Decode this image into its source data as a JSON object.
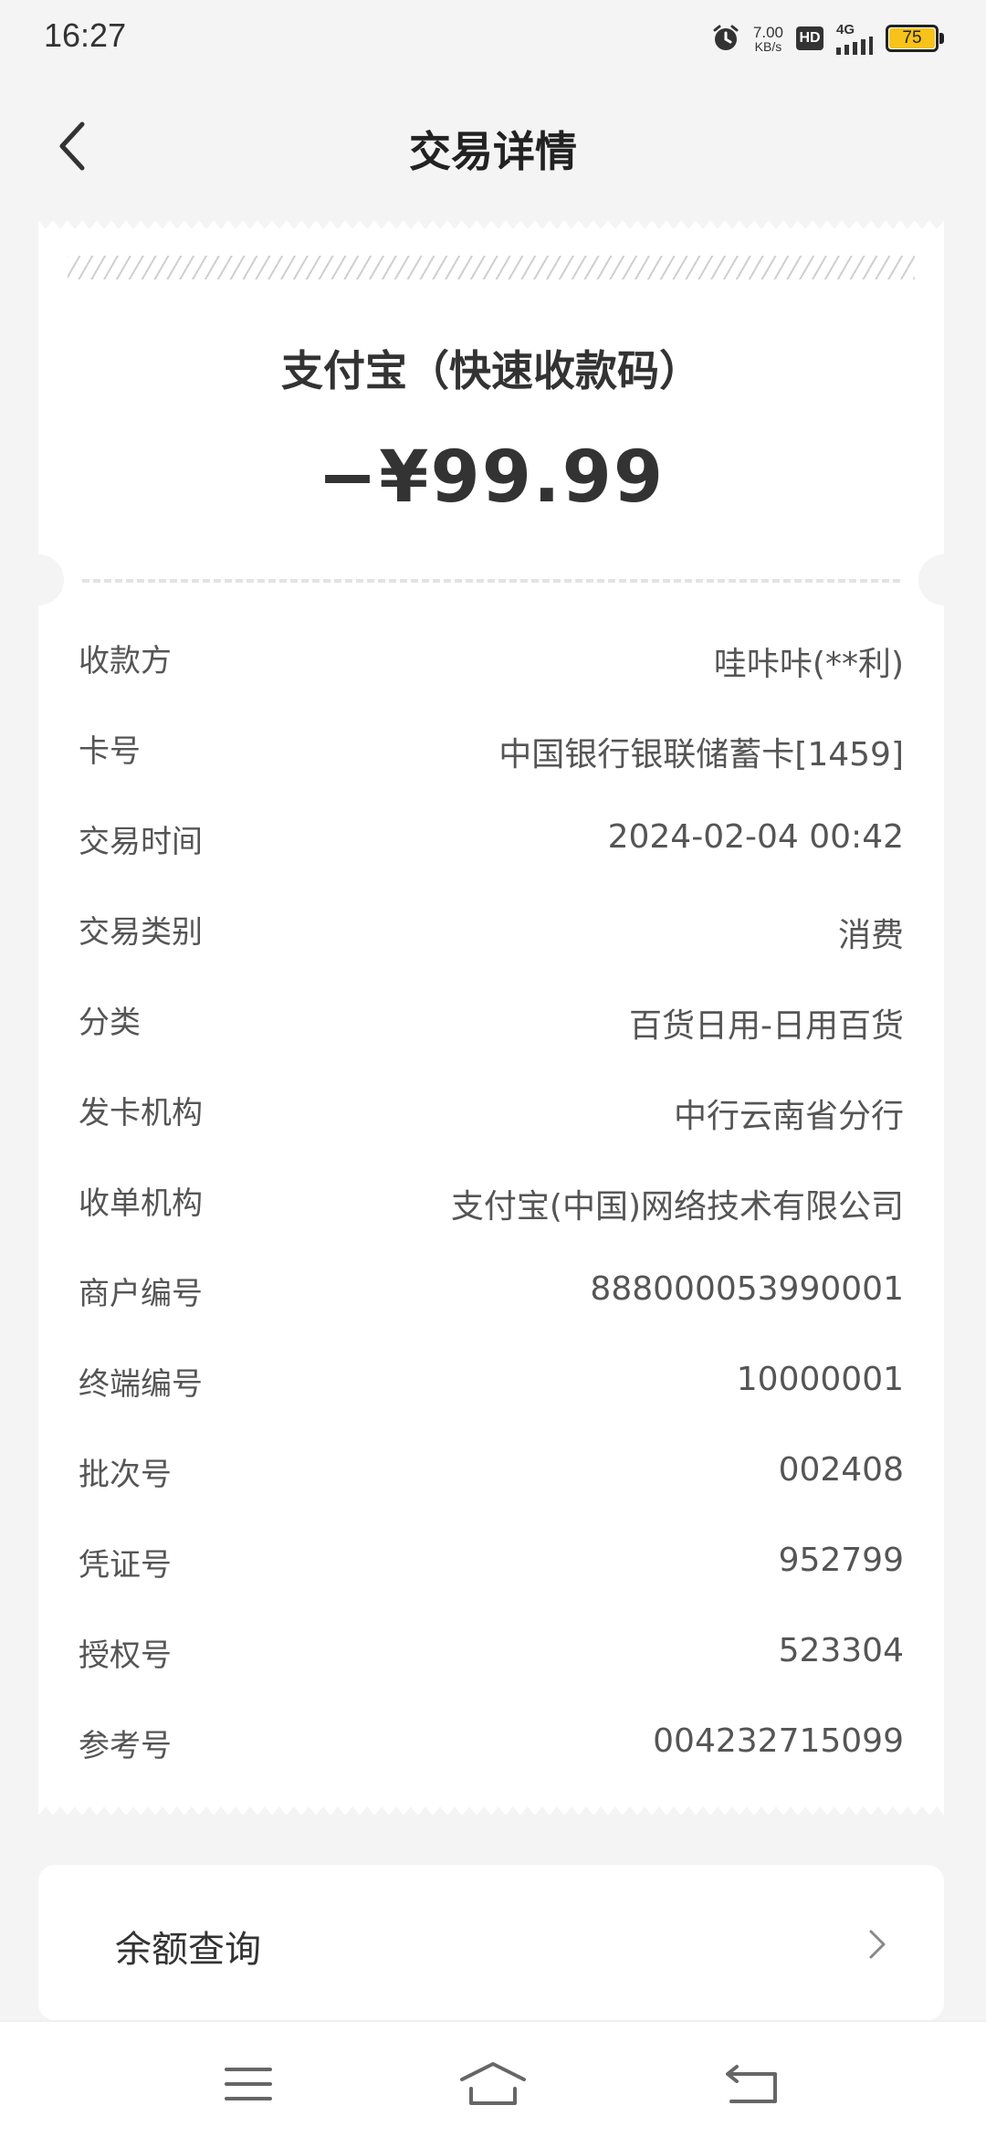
{
  "status_bar": {
    "time": "16:27",
    "net_speed_value": "7.00",
    "net_speed_unit": "KB/s",
    "hd_label": "HD",
    "network_label": "4G",
    "battery_level": "75",
    "battery_color": "#f7c21a"
  },
  "header": {
    "title": "交易详情",
    "back_icon": "chevron-left-icon"
  },
  "receipt": {
    "merchant_title": "支付宝（快速收款码）",
    "amount": "−¥99.99",
    "rows": [
      {
        "label": "收款方",
        "value": "哇咔咔(**利)"
      },
      {
        "label": "卡号",
        "value": "中国银行银联储蓄卡[1459]"
      },
      {
        "label": "交易时间",
        "value": "2024-02-04 00:42"
      },
      {
        "label": "交易类别",
        "value": "消费"
      },
      {
        "label": "分类",
        "value": "百货日用-日用百货"
      },
      {
        "label": "发卡机构",
        "value": "中行云南省分行"
      },
      {
        "label": "收单机构",
        "value": "支付宝(中国)网络技术有限公司"
      },
      {
        "label": "商户编号",
        "value": "888000053990001"
      },
      {
        "label": "终端编号",
        "value": "10000001"
      },
      {
        "label": "批次号",
        "value": "002408"
      },
      {
        "label": "凭证号",
        "value": "952799"
      },
      {
        "label": "授权号",
        "value": "523304"
      },
      {
        "label": "参考号",
        "value": "004232715099"
      }
    ]
  },
  "balance": {
    "label": "余额查询"
  },
  "nav": {
    "menu_icon": "menu-icon",
    "home_icon": "home-icon",
    "back_icon": "back-icon"
  }
}
